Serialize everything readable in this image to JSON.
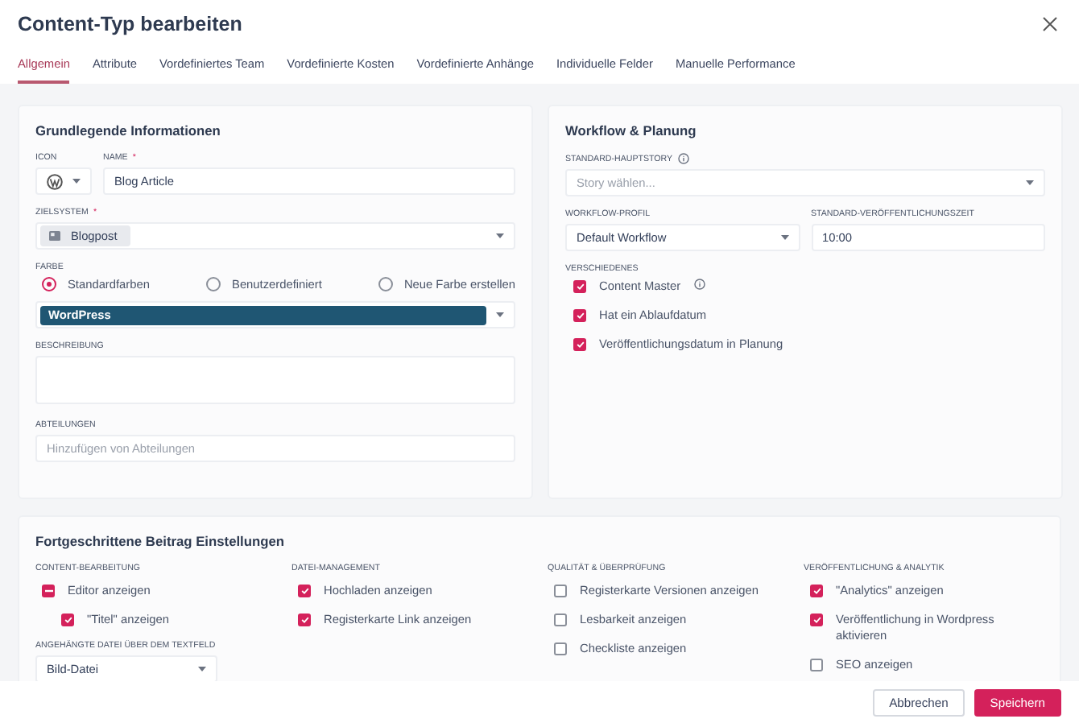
{
  "dialog": {
    "title": "Content-Typ bearbeiten"
  },
  "tabs": [
    {
      "label": "Allgemein",
      "selected": true
    },
    {
      "label": "Attribute",
      "selected": false
    },
    {
      "label": "Vordefiniertes Team",
      "selected": false
    },
    {
      "label": "Vordefinierte Kosten",
      "selected": false
    },
    {
      "label": "Vordefinierte Anhänge",
      "selected": false
    },
    {
      "label": "Individuelle Felder",
      "selected": false
    },
    {
      "label": "Manuelle Performance",
      "selected": false
    }
  ],
  "basic": {
    "title": "Grundlegende Informationen",
    "icon_label": "ICON",
    "name": {
      "label": "NAME",
      "required_mark": "*",
      "value": "Blog Article"
    },
    "target_system": {
      "label": "ZIELSYSTEM",
      "required_mark": "*",
      "value": "Blogpost"
    },
    "color": {
      "label": "FARBE",
      "options": [
        {
          "label": "Standardfarben",
          "selected": true
        },
        {
          "label": "Benutzerdefiniert",
          "selected": false
        },
        {
          "label": "Neue Farbe erstellen",
          "selected": false
        }
      ],
      "value": "WordPress",
      "color": "#1f5673"
    },
    "description": {
      "label": "BESCHREIBUNG"
    },
    "departments": {
      "label": "ABTEILUNGEN",
      "placeholder": "Hinzufügen von Abteilungen"
    }
  },
  "workflow": {
    "title": "Workflow & Planung",
    "main_story": {
      "label": "STANDARD-HAUPTSTORY",
      "placeholder": "Story wählen..."
    },
    "profile": {
      "label": "WORKFLOW-PROFIL",
      "value": "Default Workflow"
    },
    "time": {
      "label": "STANDARD-VERÖFFENTLICHUNGSZEIT",
      "value": "10:00"
    },
    "misc": {
      "label": "VERSCHIEDENES",
      "items": [
        {
          "label": "Content Master",
          "checked": true,
          "info": true
        },
        {
          "label": "Hat ein Ablaufdatum",
          "checked": true,
          "info": false
        },
        {
          "label": "Veröffentlichungsdatum in Planung",
          "checked": true,
          "info": false
        }
      ]
    }
  },
  "advanced": {
    "title": "Fortgeschrittene Beitrag Einstellungen",
    "groups": [
      {
        "title": "CONTENT-BEARBEITUNG",
        "items": [
          {
            "kind": "partial",
            "label": "Editor anzeigen",
            "checked": true,
            "children": [
              {
                "label": "\"Titel\" anzeigen",
                "checked": true
              }
            ]
          }
        ],
        "field": {
          "label": "ANGEHÄNGTE DATEI ÜBER DEM TEXTFELD",
          "value": "Bild-Datei"
        }
      },
      {
        "title": "DATEI-MANAGEMENT",
        "items": [
          {
            "kind": "checkbox",
            "label": "Hochladen anzeigen",
            "checked": true
          },
          {
            "kind": "checkbox",
            "label": "Registerkarte Link anzeigen",
            "checked": true
          }
        ]
      },
      {
        "title": "QUALITÄT & ÜBERPRÜFUNG",
        "items": [
          {
            "kind": "checkbox",
            "label": "Registerkarte Versionen anzeigen",
            "checked": false
          },
          {
            "kind": "checkbox",
            "label": "Lesbarkeit anzeigen",
            "checked": false
          },
          {
            "kind": "checkbox",
            "label": "Checkliste anzeigen",
            "checked": false
          }
        ]
      },
      {
        "title": "VERÖFFENTLICHUNG & ANALYTIK",
        "items": [
          {
            "kind": "checkbox",
            "label": "\"Analytics\" anzeigen",
            "checked": true
          },
          {
            "kind": "checkbox",
            "label": "Veröffentlichung in Wordpress aktivieren",
            "checked": true
          },
          {
            "kind": "checkbox",
            "label": "SEO anzeigen",
            "checked": false
          }
        ]
      }
    ]
  },
  "footer": {
    "cancel": "Abbrechen",
    "save": "Speichern"
  }
}
